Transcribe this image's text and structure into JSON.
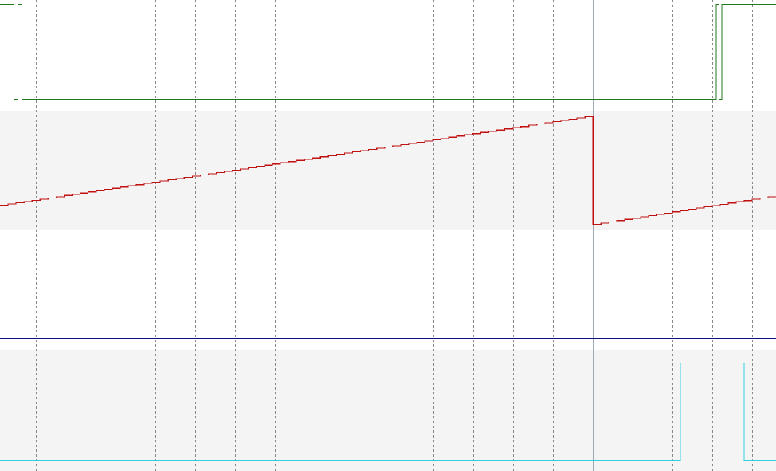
{
  "waveform_viewer": {
    "colors": {
      "background": "#ffffff",
      "lane_shade": "#f4f4f4",
      "grid": "#888888",
      "cursor": "#a0a8b8"
    },
    "lanes": [
      {
        "id": "digital-green",
        "kind": "digital",
        "color": "#1d7a1d",
        "shaded": false,
        "segments": [
          {
            "from": 0.0,
            "to": 0.35,
            "level": "high"
          },
          {
            "from": 0.35,
            "to": 0.45,
            "level": "low"
          },
          {
            "from": 0.45,
            "to": 0.55,
            "level": "high"
          },
          {
            "from": 0.55,
            "to": 18.0,
            "level": "low"
          },
          {
            "from": 18.0,
            "to": 18.07,
            "level": "high"
          },
          {
            "from": 18.07,
            "to": 18.14,
            "level": "low"
          },
          {
            "from": 18.14,
            "to": 19.5,
            "level": "high"
          }
        ]
      },
      {
        "id": "analog-red",
        "kind": "analog-staircase",
        "color": "#c01010",
        "shaded": true,
        "value_range": [
          0,
          100
        ],
        "ramps": [
          {
            "from": 0.0,
            "to": 14.9,
            "start_value": 21,
            "end_value": 95,
            "steps": 74
          },
          {
            "from": 14.9,
            "to": 19.5,
            "start_value": 5,
            "end_value": 28,
            "steps": 23
          }
        ]
      },
      {
        "id": "digital-navy",
        "kind": "digital",
        "color": "#101080",
        "shaded": false,
        "segments": [
          {
            "from": 0.0,
            "to": 19.5,
            "level": "low"
          }
        ]
      },
      {
        "id": "digital-cyan",
        "kind": "digital",
        "color": "#30d0e0",
        "shaded": true,
        "segments": [
          {
            "from": 0.0,
            "to": 17.1,
            "level": "low"
          },
          {
            "from": 17.1,
            "to": 18.7,
            "level": "high"
          },
          {
            "from": 18.7,
            "to": 19.5,
            "level": "low"
          }
        ]
      }
    ],
    "time_window": [
      0.0,
      19.5
    ],
    "grid_divisions": [
      0.9,
      1.9,
      2.9,
      3.9,
      4.9,
      5.9,
      6.9,
      7.9,
      8.9,
      9.9,
      10.9,
      11.9,
      12.9,
      13.9,
      14.9,
      15.9,
      16.9,
      17.9,
      18.9
    ],
    "cursor_time": 14.9
  }
}
